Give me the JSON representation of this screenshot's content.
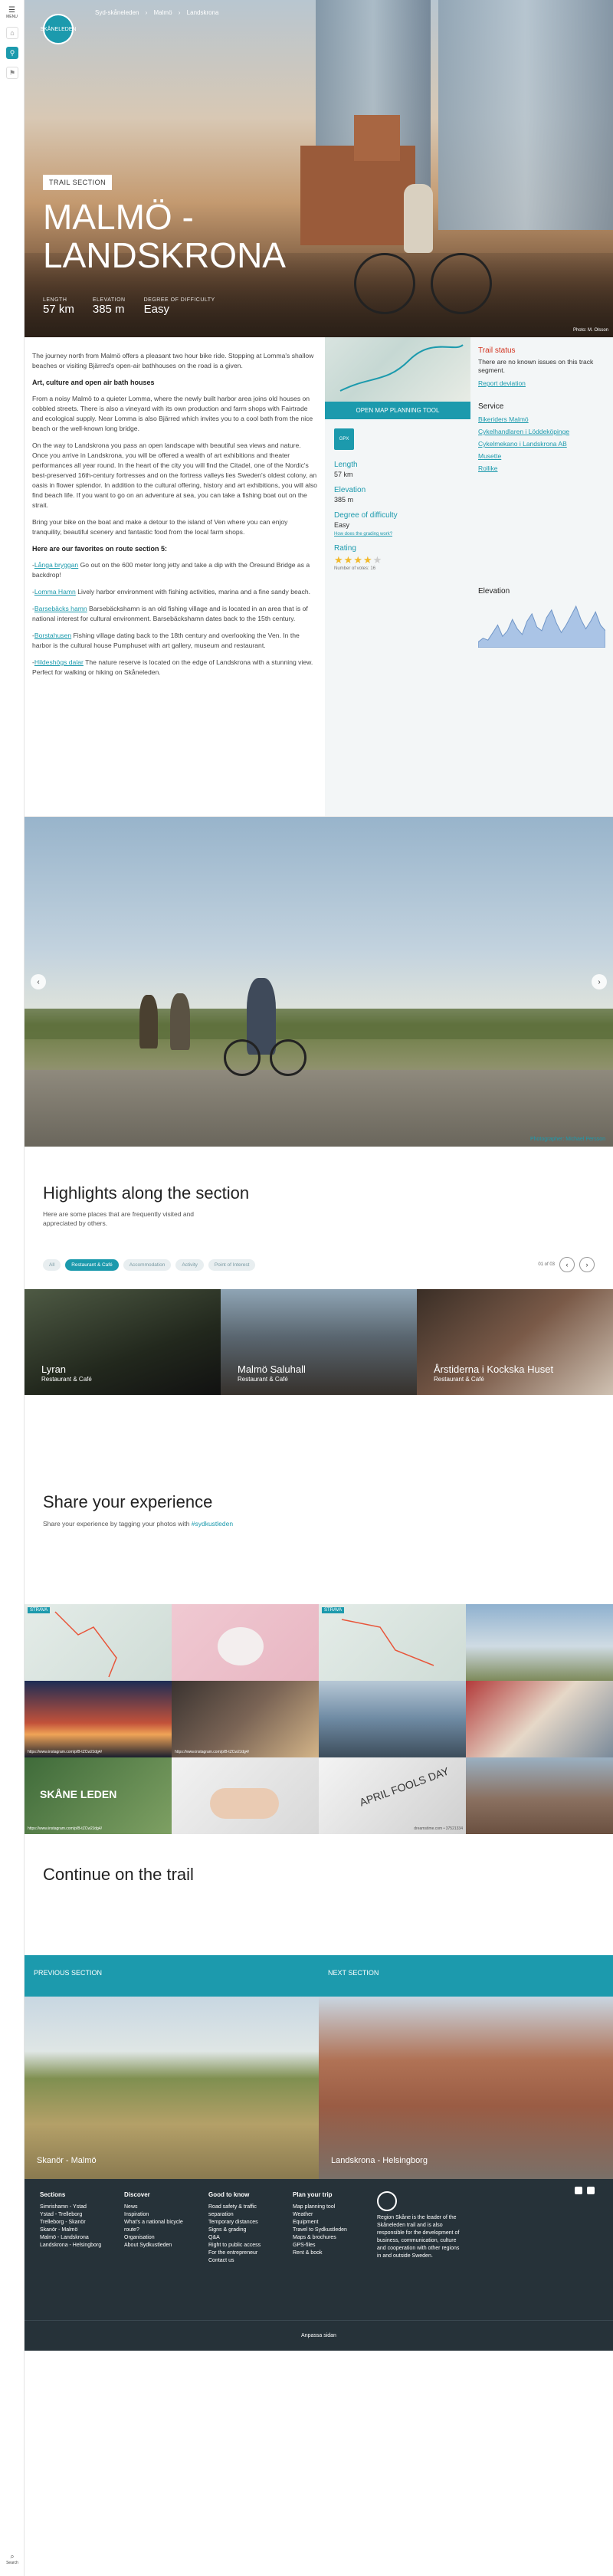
{
  "sidebar_nav": {
    "menu_label": "MENU",
    "search_label": "Search"
  },
  "hero": {
    "logo_text": "SKÅNELEDEN",
    "breadcrumbs": [
      "Syd-skåneleden",
      "Malmö",
      "Landskrona"
    ],
    "tag": "TRAIL SECTION",
    "title": "MALMÖ - LANDSKRONA",
    "stats": [
      {
        "label": "LENGTH",
        "value": "57 km"
      },
      {
        "label": "ELEVATION",
        "value": "385 m"
      },
      {
        "label": "DEGREE OF DIFFICULTY",
        "value": "Easy"
      }
    ],
    "credit": "Photo: M. Olsson"
  },
  "article": {
    "intro": "The journey north from Malmö offers a pleasant two hour bike ride. Stopping at Lomma's shallow beaches or visiting Bjärred's open-air bathhouses on the road is a given.",
    "heading1": "Art, culture and open air bath houses",
    "p1": "From a noisy Malmö to a quieter Lomma, where the newly built harbor area joins old houses on cobbled streets. There is also a vineyard with its own production and farm shops with Fairtrade and ecological supply. Near Lomma is also Bjärred which invites you to a cool bath from the nice beach or the well-known long bridge.",
    "p2": "On the way to Landskrona you pass an open landscape with beautiful sea views and nature. Once you arrive in Landskrona, you will be offered a wealth of art exhibitions and theater performances all year round. In the heart of the city you will find the Citadel, one of the Nordic's best-preserved 16th-century fortresses and on the fortress valleys lies Sweden's oldest colony, an oasis in flower splendor. In addition to the cultural offering, history and art exhibitions, you will also find beach life. If you want to go on an adventure at sea, you can take a fishing boat out on the strait.",
    "p3": "Bring your bike on the boat and make a detour to the island of Ven where you can enjoy tranquility, beautiful scenery and fantastic food from the local farm shops.",
    "heading2": "Here are our favorites on route section 5:",
    "favorites": [
      {
        "link": "Långa bryggan",
        "text": " Go out on the 600 meter long jetty and take a dip with the Öresund Bridge as a backdrop!"
      },
      {
        "link": "Lomma Hamn",
        "text": " Lively harbor environment with fishing activities, marina and a fine sandy beach."
      },
      {
        "link": "Barsebäcks hamn",
        "text": " Barsebäckshamn is an old fishing village and is located in an area that is of national interest for cultural environment. Barsebäckshamn dates back to the 15th century."
      },
      {
        "link": "Borstahusen",
        "text": " Fishing village dating back to the 18th century and overlooking the Ven. In the harbor is the cultural house Pumphuset with art gallery, museum and restaurant."
      },
      {
        "link": "Hildeshögs dalar",
        "text": " The nature reserve is located on the edge of Landskrona with a stunning view. Perfect for walking or hiking on Skåneleden."
      }
    ]
  },
  "trailinfo": {
    "map_button": "OPEN MAP PLANNING TOOL",
    "gpx_label": "GPX",
    "length_label": "Length",
    "length_value": "57 km",
    "elev_label": "Elevation",
    "elev_value": "385 m",
    "diff_label": "Degree of difficulty",
    "diff_value": "Easy",
    "diff_link": "How does the grading work?",
    "rating_label": "Rating",
    "rating_value": 3.5,
    "rating_count": "Number of votes: 16"
  },
  "status": {
    "title": "Trail status",
    "text": "There are no known issues on this track segment.",
    "report_link": "Report deviation",
    "service_title": "Service",
    "services": [
      "Bikeriders Malmö",
      "Cykelhandlaren i Löddeköpinge",
      "Cykelmekano i Landskrona AB",
      "Musette",
      "Rollike"
    ],
    "elevation_title": "Elevation",
    "elevation_profile": [
      3,
      5,
      4,
      8,
      12,
      6,
      9,
      15,
      10,
      7,
      14,
      18,
      11,
      9,
      16,
      20,
      13,
      8,
      12,
      17,
      22,
      15,
      10,
      14,
      19,
      12,
      9
    ]
  },
  "slider": {
    "caption": "Photographer: Michael Persson"
  },
  "highlights": {
    "title": "Highlights along the section",
    "subtitle": "Here are some places that are frequently visited and appreciated by others.",
    "filters": [
      "All",
      "Restaurant & Café",
      "Accommodation",
      "Activity",
      "Point of Interest"
    ],
    "active_filter": 1,
    "pager": "01 of 03",
    "cards": [
      {
        "name": "Lyran",
        "type": "Restaurant & Café"
      },
      {
        "name": "Malmö Saluhall",
        "type": "Restaurant & Café"
      },
      {
        "name": "Årstiderna i Kockska Huset",
        "type": "Restaurant & Café"
      }
    ]
  },
  "share": {
    "title": "Share your experience",
    "text_prefix": "Share your experience by tagging your photos with ",
    "hashtag": "#sydkustleden",
    "tiles": [
      "STRAVA",
      "",
      "STRAVA",
      "",
      "",
      "",
      "",
      "",
      "SKÅNE LEDEN",
      "",
      "APRIL FOOLS DAY",
      ""
    ],
    "tile_url": "https://www.instagram.com/p/B-tZCw2Jdg4/",
    "stock_caption": "dreamstime.com • 37521334"
  },
  "continue": {
    "title": "Continue on the trail",
    "prev_label": "PREVIOUS SECTION",
    "prev_name": "Skanör - Malmö",
    "next_label": "NEXT SECTION",
    "next_name": "Landskrona - Helsingborg"
  },
  "footer": {
    "columns": [
      {
        "title": "Sections",
        "items": [
          "Simrishamn - Ystad",
          "Ystad - Trelleborg",
          "Trelleborg - Skanör",
          "Skanör - Malmö",
          "Malmö - Landskrona",
          "Landskrona - Helsingborg"
        ]
      },
      {
        "title": "Discover",
        "items": [
          "News",
          "Inspiration",
          "What's a national bicycle route?",
          "Organisation",
          "About Sydkustleden"
        ]
      },
      {
        "title": "Good to know",
        "items": [
          "Road safety & traffic separation",
          "Temporary distances",
          "Signs & grading",
          "Q&A",
          "Right to public access",
          "For the entrepreneur",
          "Contact us"
        ]
      },
      {
        "title": "Plan your trip",
        "items": [
          "Map planning tool",
          "Weather",
          "Equipment",
          "Travel to Sydkustleden",
          "Maps & brochures",
          "GPS-files",
          "Rent & book"
        ]
      }
    ],
    "region_text": "Region Skåne is the leader of the Skåneleden trail and is also responsible for the development of business, communication, culture and cooperation with other regions in and outside Sweden.",
    "bottom": "Anpassa sidan"
  }
}
